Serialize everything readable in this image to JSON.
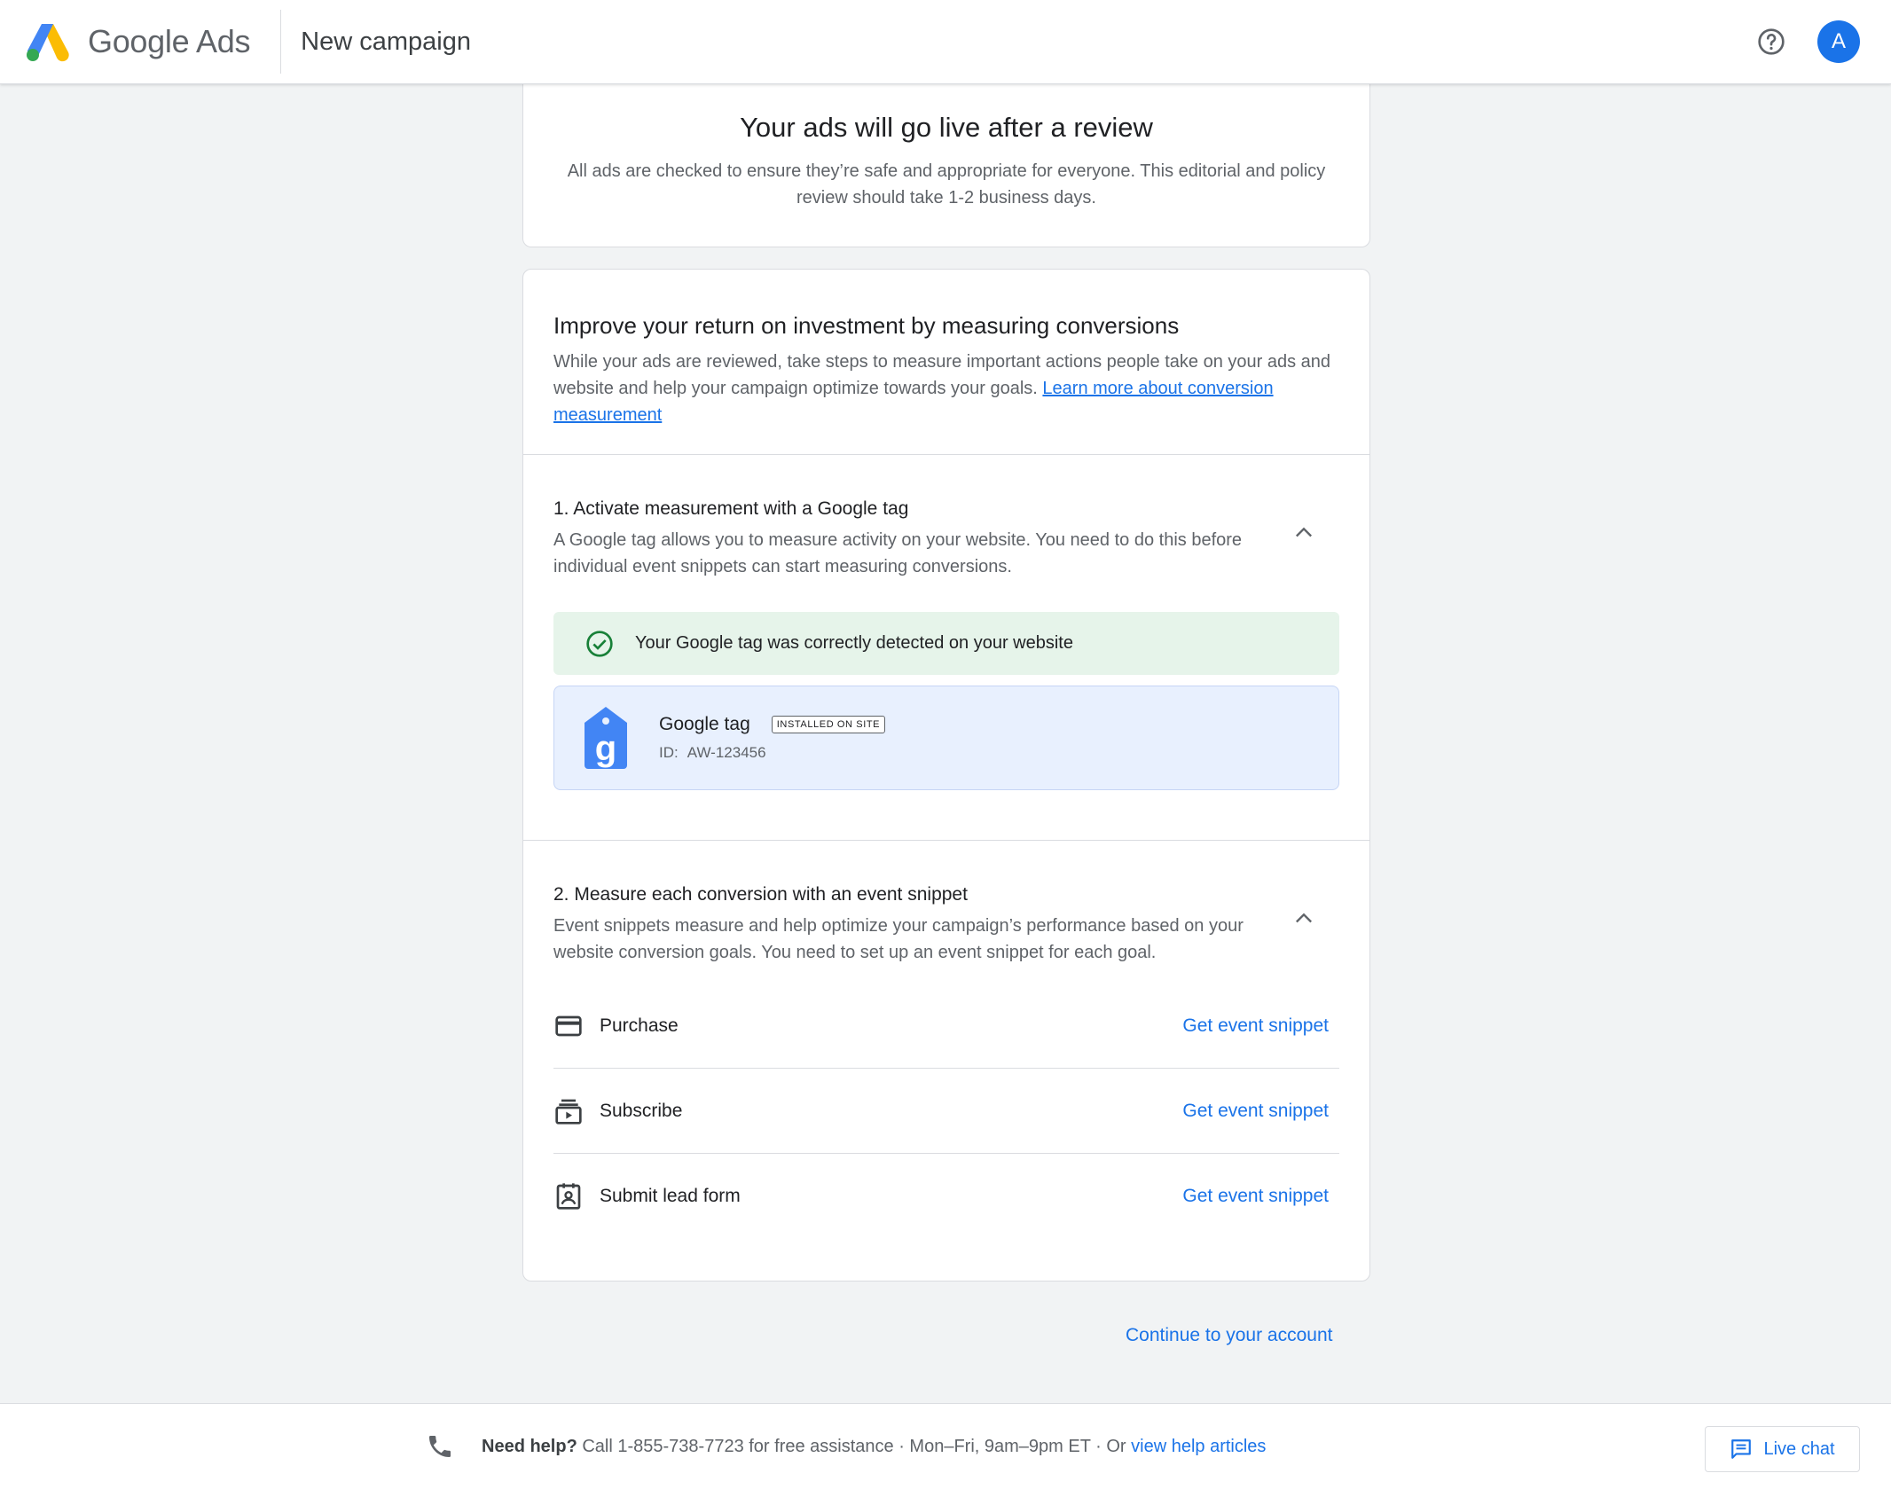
{
  "header": {
    "brand_google": "Google",
    "brand_ads": "Ads",
    "page_title": "New campaign",
    "avatar_initial": "A",
    "help_icon": "help-circle-icon"
  },
  "review": {
    "title": "Your ads will go live after a review",
    "body": "All ads are checked to ensure they’re safe and appropriate for everyone. This editorial and policy review should take 1-2 business days."
  },
  "measure": {
    "title": "Improve your return on investment by measuring conversions",
    "body": "While your ads are reviewed, take steps to measure important actions people take on your ads and website and help your campaign optimize towards your goals.",
    "link": "Learn more about conversion measurement"
  },
  "step1": {
    "title": "1. Activate measurement with a Google tag",
    "desc": "A Google tag allows you to measure activity on your website. You need to do this before individual event snippets can start measuring conversions.",
    "alert": "Your Google tag was correctly detected on your website",
    "tag_name": "Google tag",
    "tag_badge": "INSTALLED ON SITE",
    "tag_id_label": "ID:",
    "tag_id_value": "AW-123456"
  },
  "step2": {
    "title": "2. Measure each conversion with an event snippet",
    "desc": "Event snippets measure and help optimize your campaign’s performance based on your website conversion goals. You need to set up an event snippet for each goal.",
    "goals": [
      {
        "label": "Purchase",
        "action": "Get event snippet",
        "icon": "credit-card-icon"
      },
      {
        "label": "Subscribe",
        "action": "Get event snippet",
        "icon": "subscriptions-icon"
      },
      {
        "label": "Submit lead form",
        "action": "Get event snippet",
        "icon": "contact-form-icon"
      }
    ]
  },
  "continue_label": "Continue to your account",
  "footer": {
    "need_help": "Need help?",
    "call_text": " Call 1-855-738-7723 for free assistance · Mon–Fri, 9am–9pm ET · Or ",
    "help_link": "view help articles",
    "chat_label": "Live chat"
  },
  "colors": {
    "accent": "#1a73e8",
    "success_bg": "#e6f4ea",
    "success_icon": "#188038",
    "tag_bg": "#e8f0fe"
  }
}
